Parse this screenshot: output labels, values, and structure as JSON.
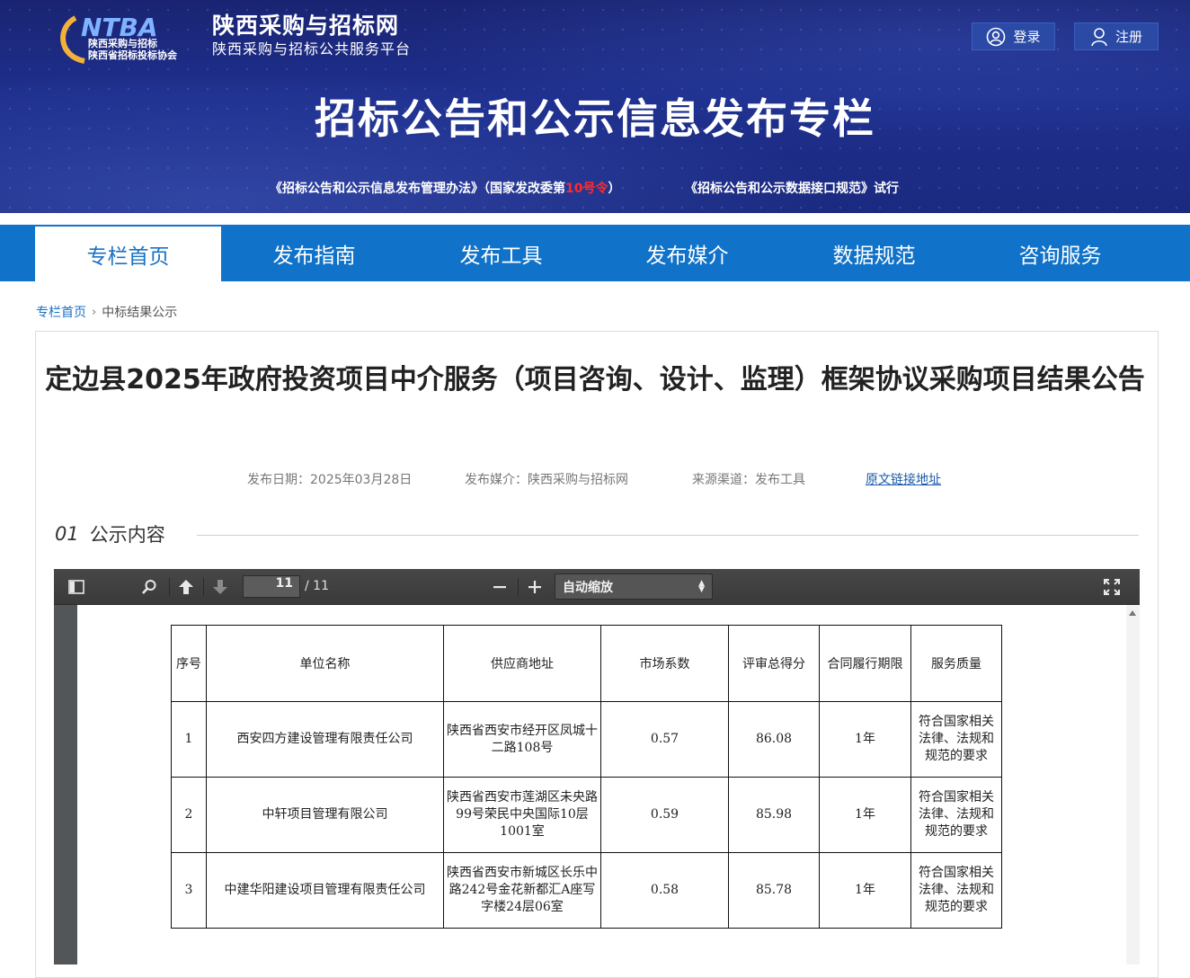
{
  "header": {
    "logo_cn_line1": "陕西采购与招标",
    "logo_cn_line2": "陕西省招标投标协会",
    "site_name": "陕西采购与招标网",
    "site_subtitle": "陕西采购与招标公共服务平台",
    "login_label": "登录",
    "register_label": "注册",
    "banner_title": "招标公告和公示信息发布专栏",
    "regulation_prefix": "《招标公告和公示信息发布管理办法》（国家发改委第",
    "regulation_number": "10号令",
    "regulation_suffix": "）",
    "spec_link": "《招标公告和公示数据接口规范》试行"
  },
  "nav": {
    "items": [
      "专栏首页",
      "发布指南",
      "发布工具",
      "发布媒介",
      "数据规范",
      "咨询服务"
    ]
  },
  "breadcrumb": {
    "home": "专栏首页",
    "current": "中标结果公示"
  },
  "article": {
    "title": "定边县2025年政府投资项目中介服务（项目咨询、设计、监理）框架协议采购项目结果公告",
    "publish_date": "发布日期：2025年03月28日",
    "media": "发布媒介：陕西采购与招标网",
    "source": "来源渠道：发布工具",
    "original_link": "原文链接地址",
    "section_num": "01",
    "section_label": "公示内容"
  },
  "viewer": {
    "page_current": "11",
    "page_total": "/ 11",
    "zoom_value": "自动缩放",
    "table": {
      "headers": [
        "序号",
        "单位名称",
        "供应商地址",
        "市场系数",
        "评审总得分",
        "合同履行期限",
        "服务质量"
      ],
      "rows": [
        [
          "1",
          "西安四方建设管理有限责任公司",
          "陕西省西安市经开区凤城十二路108号",
          "0.57",
          "86.08",
          "1年",
          "符合国家相关法律、法规和规范的要求"
        ],
        [
          "2",
          "中轩项目管理有限公司",
          "陕西省西安市莲湖区未央路99号荣民中央国际10层1001室",
          "0.59",
          "85.98",
          "1年",
          "符合国家相关法律、法规和规范的要求"
        ],
        [
          "3",
          "中建华阳建设项目管理有限责任公司",
          "陕西省西安市新城区长乐中路242号金花新都汇A座写字楼24层06室",
          "0.58",
          "85.78",
          "1年",
          "符合国家相关法律、法规和规范的要求"
        ]
      ]
    }
  },
  "colors": {
    "banner_bg": "#1e2f8d",
    "nav_bg": "#1072c8",
    "accent": "#1a72c4",
    "highlight_red": "#ff2b2b"
  }
}
